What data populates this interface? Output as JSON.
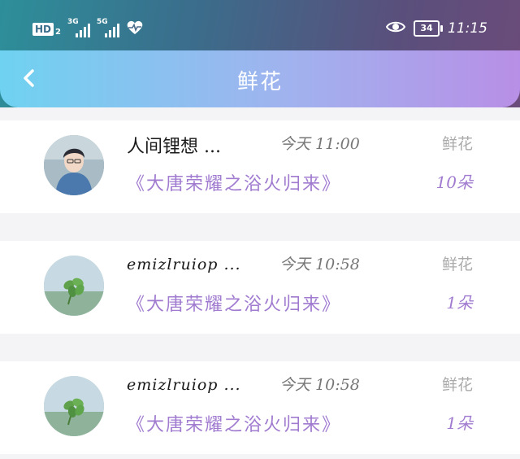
{
  "status_bar": {
    "hd": "HD",
    "hd_sub": "2",
    "net1": "3G",
    "net2": "5G",
    "battery": "34",
    "time": "11:15"
  },
  "header": {
    "title": "鲜花"
  },
  "colors": {
    "header_gradient_start": "#6fd2f0",
    "header_gradient_end": "#b88fe6",
    "accent_purple": "#a07bd0"
  },
  "items": [
    {
      "avatar": "person-photo",
      "name": "人间锂想 ...",
      "time": "今天 11:00",
      "type": "鲜花",
      "gift": "《大唐荣耀之浴火归来》",
      "count": "10朵"
    },
    {
      "avatar": "clover-photo",
      "name": "emizlruiop ...",
      "time": "今天 10:58",
      "type": "鲜花",
      "gift": "《大唐荣耀之浴火归来》",
      "count": "1朵"
    },
    {
      "avatar": "clover-photo",
      "name": "emizlruiop ...",
      "time": "今天 10:58",
      "type": "鲜花",
      "gift": "《大唐荣耀之浴火归来》",
      "count": "1朵"
    }
  ]
}
